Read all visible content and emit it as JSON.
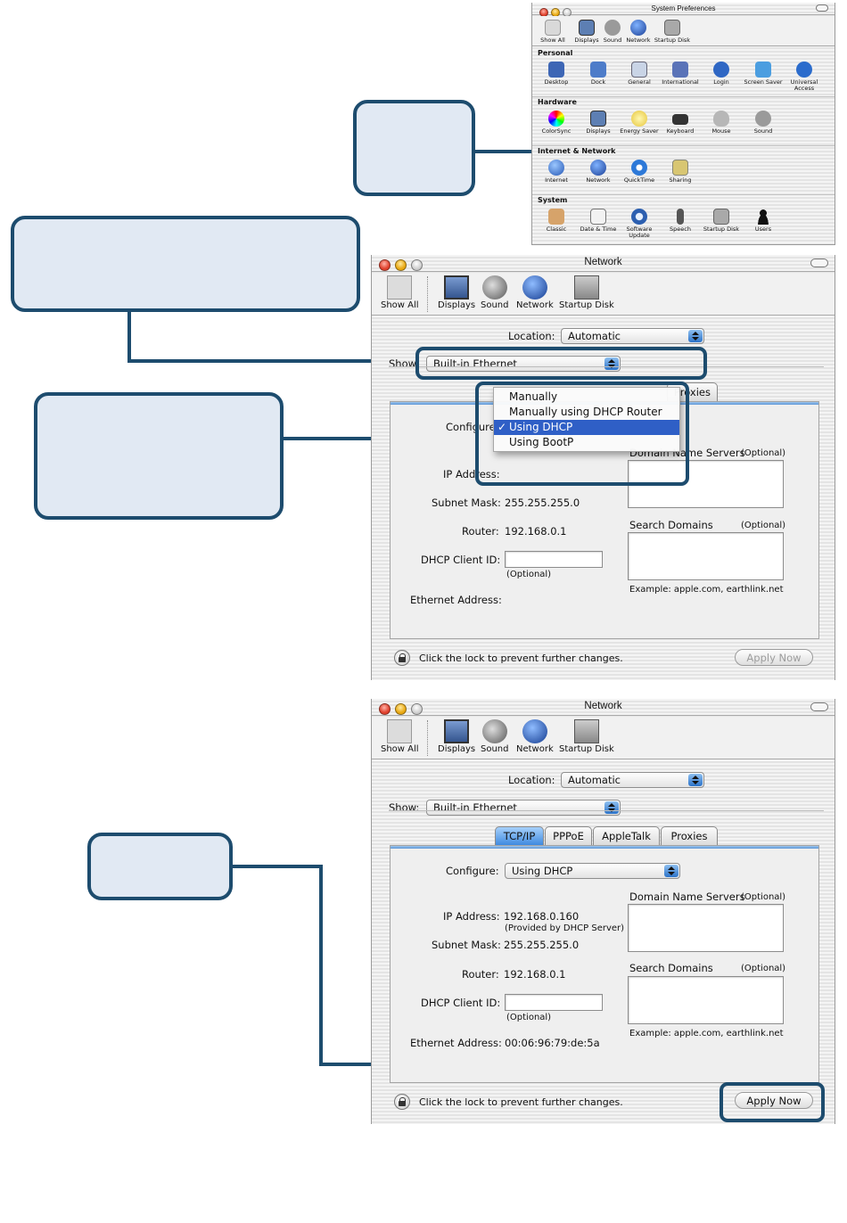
{
  "sysprefs": {
    "title": "System Preferences",
    "toolbar": [
      "Show All",
      "Displays",
      "Sound",
      "Network",
      "Startup Disk"
    ],
    "sections": [
      {
        "name": "Personal",
        "items": [
          "Desktop",
          "Dock",
          "General",
          "International",
          "Login",
          "Screen Saver",
          "Universal Access"
        ]
      },
      {
        "name": "Hardware",
        "items": [
          "ColorSync",
          "Displays",
          "Energy Saver",
          "Keyboard",
          "Mouse",
          "Sound"
        ]
      },
      {
        "name": "Internet & Network",
        "items": [
          "Internet",
          "Network",
          "QuickTime",
          "Sharing"
        ]
      },
      {
        "name": "System",
        "items": [
          "Classic",
          "Date & Time",
          "Software Update",
          "Speech",
          "Startup Disk",
          "Users"
        ]
      }
    ]
  },
  "network1": {
    "title": "Network",
    "toolbar": [
      "Show All",
      "Displays",
      "Sound",
      "Network",
      "Startup Disk"
    ],
    "location_label": "Location:",
    "location_value": "Automatic",
    "show_label": "Show:",
    "show_value": "Built-in Ethernet",
    "tab_visible": "Proxies",
    "configure_label": "Configure",
    "menu_items": [
      "Manually",
      "Manually using DHCP Router",
      "Using DHCP",
      "Using BootP"
    ],
    "dns_label": "Domain Name Servers",
    "optional": "(Optional)",
    "ip_label": "IP Address:",
    "subnet_label": "Subnet Mask:",
    "subnet_value": "255.255.255.0",
    "router_label": "Router:",
    "router_value": "192.168.0.1",
    "search_label": "Search Domains",
    "dhcp_label": "DHCP Client ID:",
    "dhcp_optional": "(Optional)",
    "example": "Example: apple.com, earthlink.net",
    "ethernet_label": "Ethernet Address:",
    "lock_text": "Click the lock to prevent further changes.",
    "apply": "Apply Now"
  },
  "network2": {
    "title": "Network",
    "toolbar": [
      "Show All",
      "Displays",
      "Sound",
      "Network",
      "Startup Disk"
    ],
    "location_label": "Location:",
    "location_value": "Automatic",
    "show_label": "Show:",
    "show_value": "Built-in Ethernet",
    "tabs": [
      "TCP/IP",
      "PPPoE",
      "AppleTalk",
      "Proxies"
    ],
    "configure_label": "Configure:",
    "configure_value": "Using DHCP",
    "dns_label": "Domain Name Servers",
    "optional": "(Optional)",
    "ip_label": "IP Address:",
    "ip_value": "192.168.0.160",
    "ip_note": "(Provided by DHCP Server)",
    "subnet_label": "Subnet Mask:",
    "subnet_value": "255.255.255.0",
    "router_label": "Router:",
    "router_value": "192.168.0.1",
    "search_label": "Search Domains",
    "dhcp_label": "DHCP Client ID:",
    "dhcp_optional": "(Optional)",
    "example": "Example: apple.com, earthlink.net",
    "ethernet_label": "Ethernet Address:",
    "ethernet_value": "00:06:96:79:de:5a",
    "lock_text": "Click the lock to prevent further changes.",
    "apply": "Apply Now"
  },
  "colors": {
    "callout_fill": "#e1e9f3",
    "callout_border": "#1d4c6e",
    "selection": "#2f5fc6",
    "aqua": "#3f8ae0"
  },
  "icons": [
    "apple-icon",
    "monitor-icon",
    "speaker-icon",
    "globe-icon",
    "disk-icon",
    "lock-icon",
    "checkmark-icon"
  ]
}
